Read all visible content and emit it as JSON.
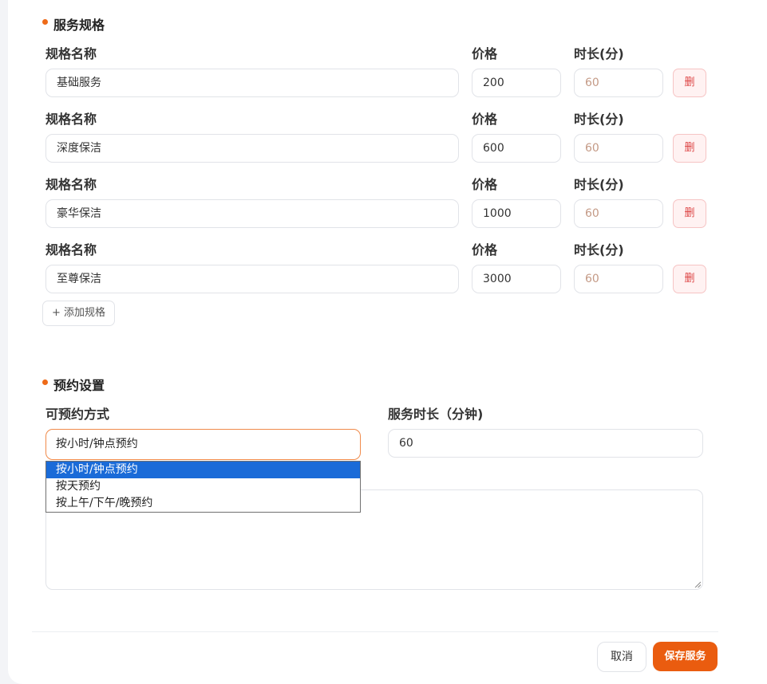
{
  "spec_section": {
    "title": "服务规格",
    "name_label": "规格名称",
    "price_label": "价格",
    "duration_label": "时长(分)",
    "delete_label": "删",
    "rows": [
      {
        "name": "基础服务",
        "price": "200",
        "duration": "60"
      },
      {
        "name": "深度保洁",
        "price": "600",
        "duration": "60"
      },
      {
        "name": "豪华保洁",
        "price": "1000",
        "duration": "60"
      },
      {
        "name": "至尊保洁",
        "price": "3000",
        "duration": "60"
      }
    ],
    "add_button": "+ 添加规格"
  },
  "booking_section": {
    "title": "预约设置",
    "method_label": "可预约方式",
    "selected_method": "按小时/钟点预约",
    "method_options": [
      "按小时/钟点预约",
      "按天预约",
      "按上午/下午/晚预约"
    ],
    "duration_label": "服务时长（分钟)",
    "duration_value": "60"
  },
  "footer": {
    "cancel_label": "取消",
    "save_label": "保存服务"
  },
  "colors": {
    "accent": "#ea5c0f",
    "dropdown_highlight": "#1a6bd8",
    "delete": "#d44444"
  }
}
